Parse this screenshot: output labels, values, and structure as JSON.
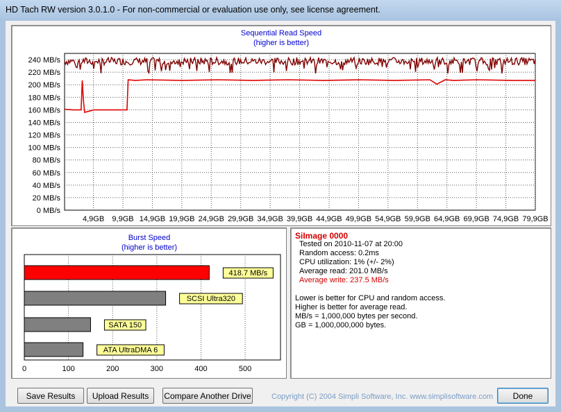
{
  "window": {
    "title": "HD Tach RW version 3.0.1.0  - For non-commercial or evaluation use only, see license agreement."
  },
  "sequential": {
    "title": "Sequential Read Speed",
    "subtitle": "(higher is better)"
  },
  "burst": {
    "title": "Burst Speed",
    "subtitle": "(higher is better)"
  },
  "info": {
    "drive_name": "SiImage 0000",
    "tested_on": "Tested on 2010-11-07 at 20:00",
    "random_access": "Random access: 0.2ms",
    "cpu_utilization": "CPU utilization: 1% (+/- 2%)",
    "average_read": "Average read: 201.0 MB/s",
    "average_write": "Average write: 237.5 MB/s",
    "note_1": "Lower is better for CPU and random access.",
    "note_2": "Higher is better for average read.",
    "note_3": "MB/s = 1,000,000 bytes per second.",
    "note_4": "GB = 1,000,000,000 bytes."
  },
  "buttons": {
    "save": "Save Results",
    "upload": "Upload Results",
    "compare": "Compare Another Drive",
    "done": "Done"
  },
  "copyright": "Copyright (C) 2004 Simpli Software, Inc. www.simplisoftware.com",
  "colors": {
    "read": "#e00000",
    "write": "#800000",
    "highlight_bar": "#ff0000",
    "reference_bar": "#808080",
    "label_bg": "#ffff99"
  },
  "chart_data": [
    {
      "type": "line",
      "title": "Sequential Read Speed",
      "subtitle": "(higher is better)",
      "y_ticks": [
        "0 MB/s",
        "20 MB/s",
        "40 MB/s",
        "60 MB/s",
        "80 MB/s",
        "100 MB/s",
        "120 MB/s",
        "140 MB/s",
        "160 MB/s",
        "180 MB/s",
        "200 MB/s",
        "220 MB/s",
        "240 MB/s"
      ],
      "x_ticks": [
        "4,9GB",
        "9,9GB",
        "14,9GB",
        "19,9GB",
        "24,9GB",
        "29,9GB",
        "34,9GB",
        "39,9GB",
        "44,9GB",
        "49,9GB",
        "54,9GB",
        "59,9GB",
        "64,9GB",
        "69,9GB",
        "74,9GB",
        "79,9GB"
      ],
      "xlim": [
        0,
        79.9
      ],
      "ylim": [
        0,
        250
      ],
      "grid": true,
      "series": [
        {
          "values_x": [
            0,
            1.5,
            2.8,
            3.0,
            3.2,
            3.4,
            5,
            7,
            9.5,
            10.6,
            10.8,
            12,
            14,
            20,
            26,
            32,
            38,
            44,
            50,
            56,
            62,
            63.2,
            64.6,
            66,
            70,
            76,
            79.9
          ],
          "values_y": [
            161,
            160,
            160,
            207,
            174,
            156,
            160,
            160,
            160,
            160,
            208,
            207,
            208,
            207,
            208,
            207,
            208,
            207,
            208,
            207,
            208,
            201,
            208,
            207,
            208,
            207,
            207
          ]
        },
        {
          "values_x": [
            0,
            79.9
          ],
          "values_y": [
            237.5,
            237.5
          ]
        }
      ]
    },
    {
      "type": "bar",
      "title": "Burst Speed",
      "subtitle": "(higher is better)",
      "categories": [
        "418.7 MB/s",
        "SCSI Ultra320",
        "SATA 150",
        "ATA UltraDMA 6"
      ],
      "values": [
        418.7,
        320,
        150,
        133
      ],
      "x_ticks": [
        "0",
        "100",
        "200",
        "300",
        "400",
        "500"
      ],
      "xlim": [
        0,
        580
      ]
    }
  ]
}
